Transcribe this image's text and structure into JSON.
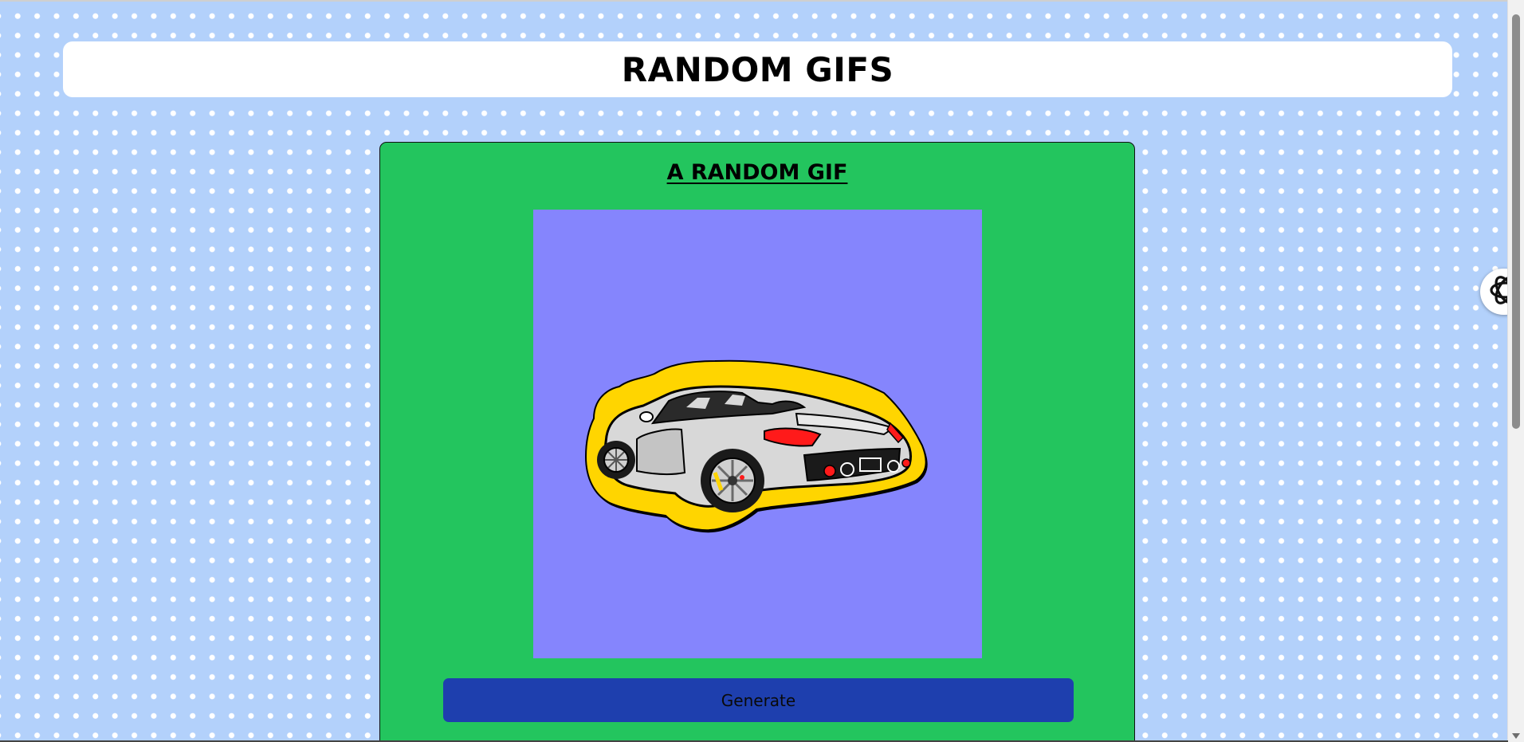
{
  "header": {
    "title": "RANDOM GIFS"
  },
  "card": {
    "title": "A RANDOM GIF",
    "image_subject": "silver sports car sticker",
    "generate_label": "Generate"
  },
  "floating_button": {
    "icon": "openai-logo-icon"
  },
  "colors": {
    "page_background": "#b3d1fb",
    "dots": "#ffffff",
    "card_background": "#23c55e",
    "gif_background": "#8585fd",
    "button_background": "#1e3fae",
    "sticker_outline": "#ffd500"
  }
}
